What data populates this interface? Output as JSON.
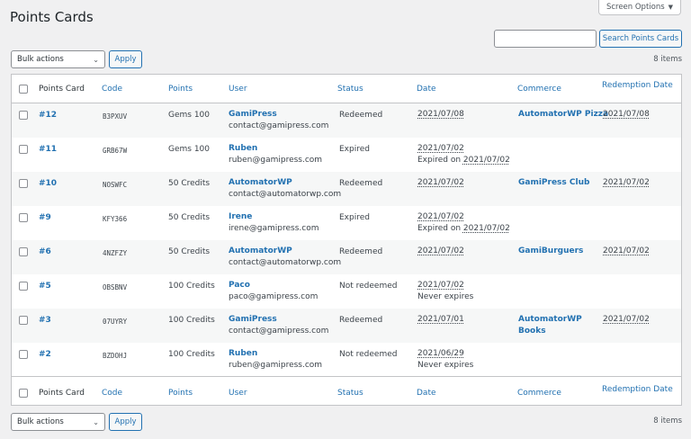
{
  "page": {
    "title": "Points Cards"
  },
  "screen_options": {
    "label": "Screen Options",
    "caret": "▼"
  },
  "search": {
    "placeholder": "",
    "button_label": "Search Points Cards"
  },
  "bulk": {
    "label": "Bulk actions",
    "apply_label": "Apply",
    "chevron": "⌄"
  },
  "item_count": "8 items",
  "columns": {
    "card": "Points Card",
    "code": "Code",
    "points": "Points",
    "user": "User",
    "status": "Status",
    "date": "Date",
    "commerce": "Commerce",
    "redemption": "Redemption Date"
  },
  "rows": [
    {
      "card": "#12",
      "code": "B3PXUV",
      "points": "Gems 100",
      "user_name": "GamiPress",
      "user_email": "contact@gamipress.com",
      "status": "Redeemed",
      "date": "2021/07/08",
      "date_note_prefix": "",
      "date_note_date": "",
      "commerce_line1": "AutomatorWP Pizza",
      "commerce_line2": "",
      "redemption": "2021/07/08"
    },
    {
      "card": "#11",
      "code": "GRB67W",
      "points": "Gems 100",
      "user_name": "Ruben",
      "user_email": "ruben@gamipress.com",
      "status": "Expired",
      "date": "2021/07/02",
      "date_note_prefix": "Expired on ",
      "date_note_date": "2021/07/02",
      "commerce_line1": "",
      "commerce_line2": "",
      "redemption": ""
    },
    {
      "card": "#10",
      "code": "NOSWFC",
      "points": "50 Credits",
      "user_name": "AutomatorWP",
      "user_email": "contact@automatorwp.com",
      "status": "Redeemed",
      "date": "2021/07/02",
      "date_note_prefix": "",
      "date_note_date": "",
      "commerce_line1": "GamiPress Club",
      "commerce_line2": "",
      "redemption": "2021/07/02"
    },
    {
      "card": "#9",
      "code": "KFY366",
      "points": "50 Credits",
      "user_name": "Irene",
      "user_email": "irene@gamipress.com",
      "status": "Expired",
      "date": "2021/07/02",
      "date_note_prefix": "Expired on ",
      "date_note_date": "2021/07/02",
      "commerce_line1": "",
      "commerce_line2": "",
      "redemption": ""
    },
    {
      "card": "#6",
      "code": "4NZFZY",
      "points": "50 Credits",
      "user_name": "AutomatorWP",
      "user_email": "contact@automatorwp.com",
      "status": "Redeemed",
      "date": "2021/07/02",
      "date_note_prefix": "",
      "date_note_date": "",
      "commerce_line1": "GamiBurguers",
      "commerce_line2": "",
      "redemption": "2021/07/02"
    },
    {
      "card": "#5",
      "code": "OBSBNV",
      "points": "100 Credits",
      "user_name": "Paco",
      "user_email": "paco@gamipress.com",
      "status": "Not redeemed",
      "date": "2021/07/02",
      "date_note_prefix": "Never expires",
      "date_note_date": "",
      "commerce_line1": "",
      "commerce_line2": "",
      "redemption": ""
    },
    {
      "card": "#3",
      "code": "07UYRY",
      "points": "100 Credits",
      "user_name": "GamiPress",
      "user_email": "contact@gamipress.com",
      "status": "Redeemed",
      "date": "2021/07/01",
      "date_note_prefix": "",
      "date_note_date": "",
      "commerce_line1": "AutomatorWP",
      "commerce_line2": "Books",
      "redemption": "2021/07/02"
    },
    {
      "card": "#2",
      "code": "BZDOHJ",
      "points": "100 Credits",
      "user_name": "Ruben",
      "user_email": "ruben@gamipress.com",
      "status": "Not redeemed",
      "date": "2021/06/29",
      "date_note_prefix": "Never expires",
      "date_note_date": "",
      "commerce_line1": "",
      "commerce_line2": "",
      "redemption": ""
    }
  ]
}
